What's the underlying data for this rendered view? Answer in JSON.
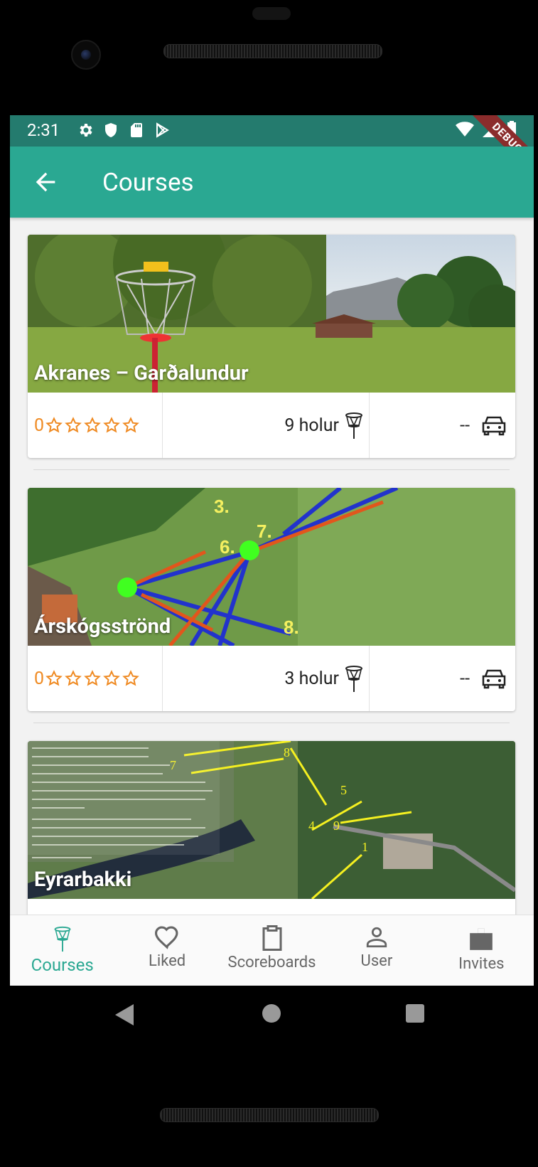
{
  "status_bar": {
    "time": "2:31",
    "debug_label": "DEBUG"
  },
  "app_bar": {
    "title": "Courses"
  },
  "courses": [
    {
      "name": "Akranes – Garðalundur",
      "rating": "0",
      "stars_filled": 0,
      "holes": "9 holur",
      "distance": "--"
    },
    {
      "name": "Árskógsströnd",
      "rating": "0",
      "stars_filled": 0,
      "holes": "3 holur",
      "distance": "--"
    },
    {
      "name": "Eyrarbakki",
      "rating": "0",
      "stars_filled": 0,
      "holes": "",
      "distance": ""
    }
  ],
  "bottom_nav": {
    "items": [
      {
        "label": "Courses",
        "icon": "disc-golf-basket-icon",
        "active": true
      },
      {
        "label": "Liked",
        "icon": "heart-icon",
        "active": false
      },
      {
        "label": "Scoreboards",
        "icon": "clipboard-icon",
        "active": false
      },
      {
        "label": "User",
        "icon": "user-icon",
        "active": false
      },
      {
        "label": "Invites",
        "icon": "invites-icon",
        "active": false
      }
    ]
  },
  "colors": {
    "status_bar": "#247b6e",
    "app_bar": "#2aa892",
    "accent": "#2aa892",
    "rating": "#ef8a22"
  }
}
